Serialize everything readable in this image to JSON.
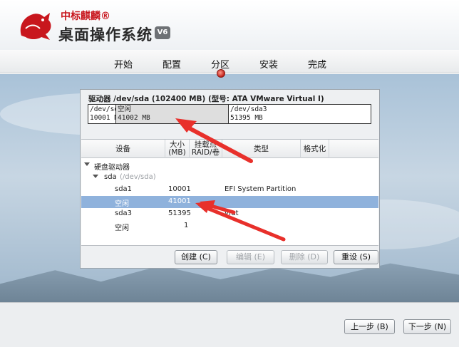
{
  "header": {
    "brand": "中标麒麟®",
    "product": "桌面操作系统",
    "version_badge": "V6"
  },
  "steps": [
    {
      "label": "开始"
    },
    {
      "label": "配置"
    },
    {
      "label": "分区",
      "active": true
    },
    {
      "label": "安装"
    },
    {
      "label": "完成"
    }
  ],
  "drive": {
    "title": "驱动器 /dev/sda (102400 MB) (型号: ATA VMware Virtual I)",
    "segments": [
      {
        "line1": "/dev/sda",
        "line2": "10001 M"
      },
      {
        "line1": "空闲",
        "line2": "41002 MB"
      },
      {
        "line1": "/dev/sda3",
        "line2": "51395 MB"
      }
    ]
  },
  "table": {
    "headers": {
      "device": "设备",
      "size_l1": "大小",
      "size_l2": "(MB)",
      "mount_l1": "挂载点",
      "mount_l2": "RAID/卷",
      "type": "类型",
      "format": "格式化"
    },
    "root_label": "硬盘驱动器",
    "disk_label": "sda",
    "disk_path": "(/dev/sda)",
    "rows": [
      {
        "device": "sda1",
        "size": "10001",
        "type": "EFI System Partition"
      },
      {
        "device": "空闲",
        "size": "41001",
        "type": ""
      },
      {
        "device": "sda3",
        "size": "51395",
        "type": "vfat"
      },
      {
        "device": "空闲",
        "size": "1",
        "type": ""
      }
    ]
  },
  "panel_buttons": {
    "create": "创建 (C)",
    "edit": "编辑 (E)",
    "delete": "删除 (D)",
    "reset": "重设 (S)"
  },
  "footer": {
    "back": "上一步 (B)",
    "next": "下一步 (N)"
  },
  "colors": {
    "selection": "#8fb2dc",
    "free_segment": "#dedede",
    "arrow": "#e8302b",
    "brand_red": "#c8161d"
  }
}
